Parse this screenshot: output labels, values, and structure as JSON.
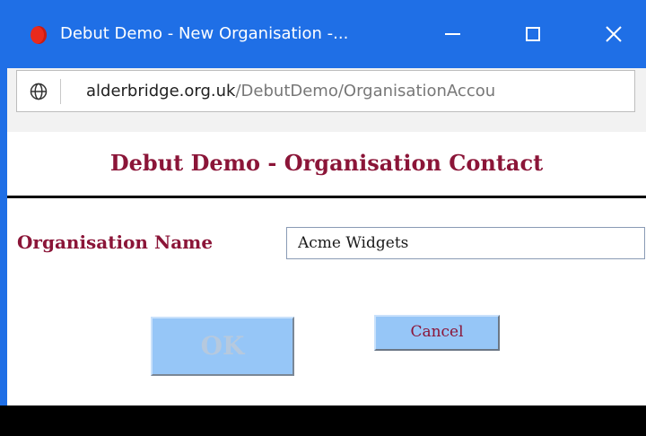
{
  "window": {
    "title": "Debut Demo - New Organisation -...",
    "app_icon": "opera-icon",
    "controls": {
      "minimize": "minimize-icon",
      "maximize": "maximize-icon",
      "close": "close-icon"
    },
    "accent_color": "#1f6fe6"
  },
  "address_bar": {
    "icon": "globe-icon",
    "url_domain": "alderbridge.org.uk",
    "url_path": "/DebutDemo/OrganisationAccou"
  },
  "page": {
    "heading": "Debut Demo - Organisation Contact",
    "heading_color": "#8b1538",
    "form": {
      "organisation_name_label": "Organisation Name",
      "organisation_name_value": "Acme Widgets"
    },
    "buttons": {
      "ok_label": "OK",
      "cancel_label": "Cancel",
      "button_color": "#96c6f7"
    }
  }
}
